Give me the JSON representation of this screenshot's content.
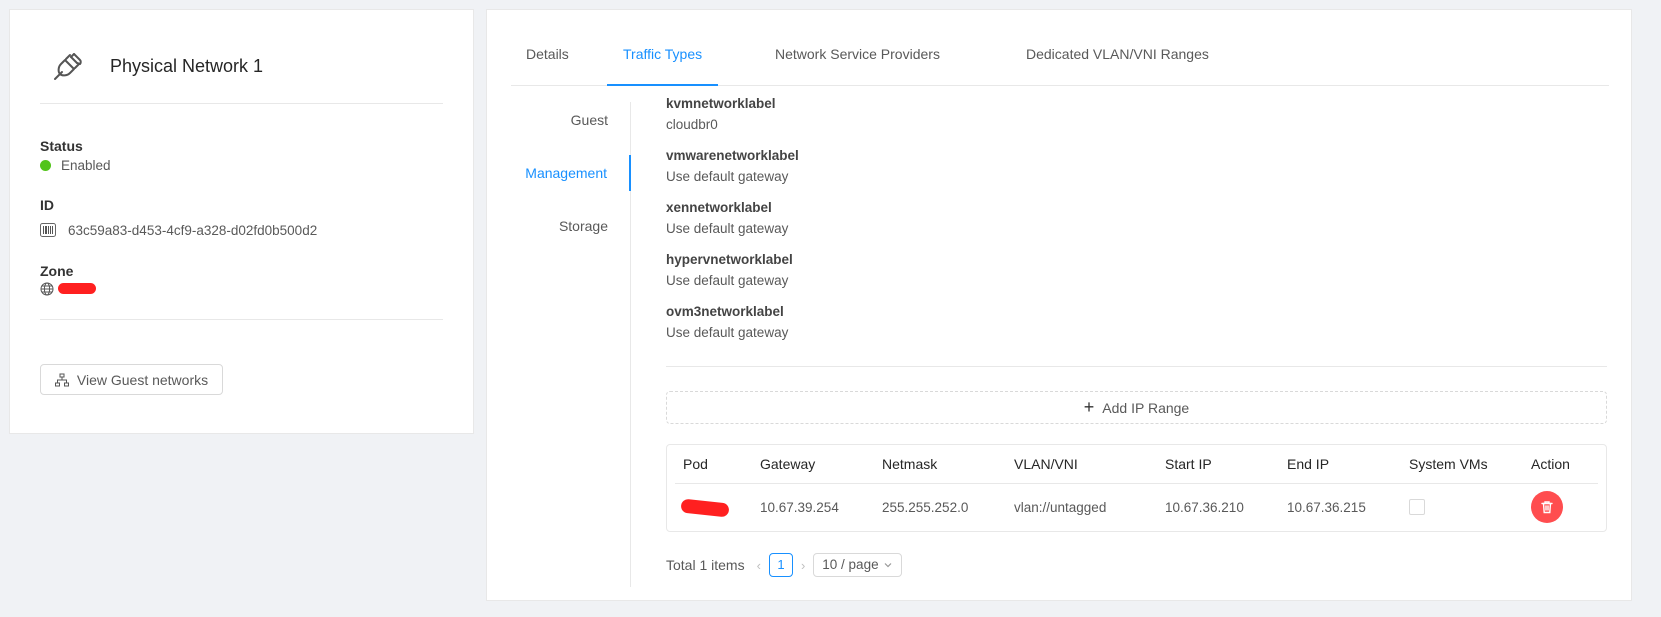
{
  "network": {
    "name": "Physical Network 1",
    "status_label": "Status",
    "status_value": "Enabled",
    "id_label": "ID",
    "id_value": "63c59a83-d453-4cf9-a328-d02fd0b500d2",
    "zone_label": "Zone",
    "view_guest_button": "View Guest networks"
  },
  "tabs": [
    "Details",
    "Traffic Types",
    "Network Service Providers",
    "Dedicated VLAN/VNI Ranges"
  ],
  "active_tab": "Traffic Types",
  "traffic_tabs": [
    "Guest",
    "Management",
    "Storage"
  ],
  "active_traffic_tab": "Management",
  "labels": [
    {
      "key": "kvmnetworklabel",
      "value": "cloudbr0"
    },
    {
      "key": "vmwarenetworklabel",
      "value": "Use default gateway"
    },
    {
      "key": "xennetworklabel",
      "value": "Use default gateway"
    },
    {
      "key": "hypervnetworklabel",
      "value": "Use default gateway"
    },
    {
      "key": "ovm3networklabel",
      "value": "Use default gateway"
    }
  ],
  "add_ip_range": "Add IP Range",
  "table": {
    "columns": [
      "Pod",
      "Gateway",
      "Netmask",
      "VLAN/VNI",
      "Start IP",
      "End IP",
      "System VMs",
      "Action"
    ],
    "rows": [
      {
        "pod": "",
        "gateway": "10.67.39.254",
        "netmask": "255.255.252.0",
        "vlan": "vlan://untagged",
        "start_ip": "10.67.36.210",
        "end_ip": "10.67.36.215",
        "system_vms": false
      }
    ]
  },
  "pagination": {
    "total": "Total 1 items",
    "current_page": "1",
    "page_size": "10 / page"
  },
  "colors": {
    "accent": "#1890ff",
    "enabled": "#52c41a",
    "danger": "#ff4d4f"
  }
}
